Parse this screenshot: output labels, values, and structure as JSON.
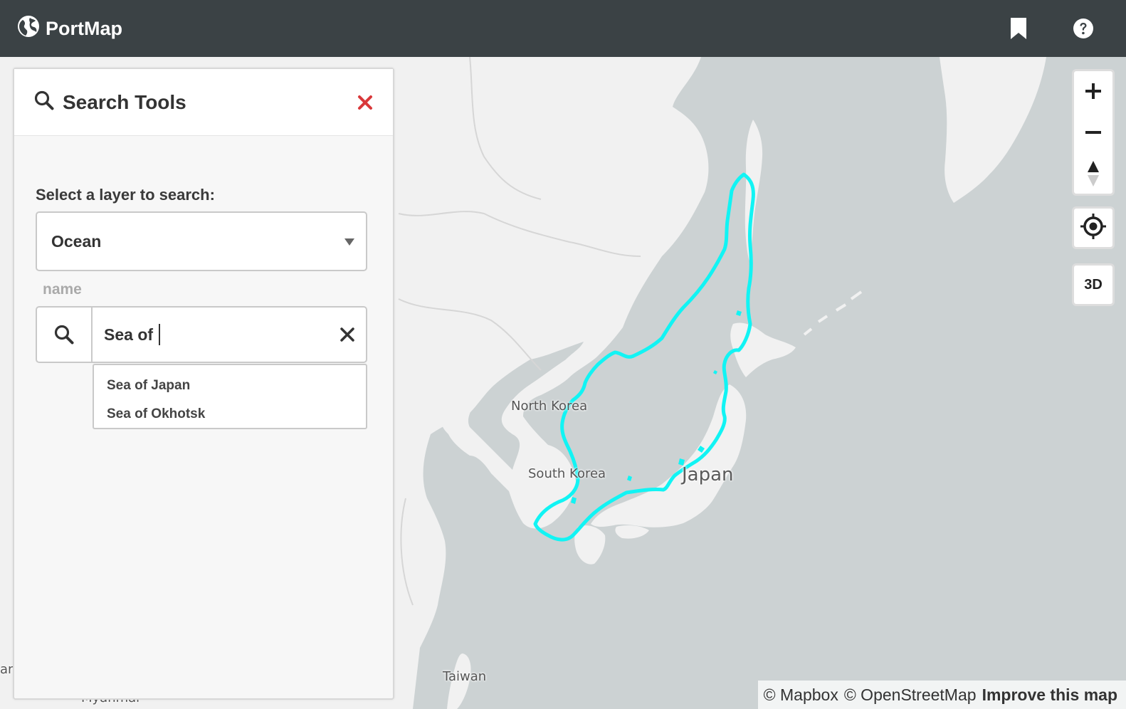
{
  "app": {
    "title": "PortMap",
    "logo_icon": "globe-icon",
    "bookmark_icon": "bookmark-icon",
    "help_icon": "help-icon"
  },
  "search_panel": {
    "title": "Search Tools",
    "layer_label": "Select a layer to search:",
    "layer_value": "Ocean",
    "field_label": "name",
    "query": "Sea of",
    "suggestions": [
      "Sea of Japan",
      "Sea of Okhotsk"
    ],
    "accent_close_color": "#d9383a"
  },
  "map": {
    "labels": {
      "north_korea": "North Korea",
      "south_korea": "South Korea",
      "japan": "Japan",
      "taiwan": "Taiwan",
      "myanmar": "Myanmar",
      "edge_fragment": "an"
    },
    "highlight_color": "#11f4f4",
    "land_color": "#f1f1f1",
    "water_color": "#ccd2d3"
  },
  "controls": {
    "zoom_in_icon": "plus-icon",
    "zoom_out_icon": "minus-icon",
    "compass_icon": "compass-icon",
    "locate_icon": "locate-icon",
    "three_d_label": "3D"
  },
  "attribution": {
    "mapbox": "© Mapbox",
    "osm": "© OpenStreetMap",
    "improve": "Improve this map"
  }
}
